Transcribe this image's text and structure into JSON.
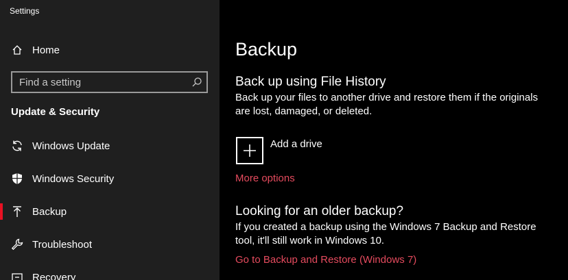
{
  "app": {
    "title": "Settings"
  },
  "colors": {
    "accent": "#e81123",
    "link": "#e54b5e"
  },
  "sidebar": {
    "home_label": "Home",
    "search": {
      "placeholder": "Find a setting",
      "value": ""
    },
    "section_header": "Update & Security",
    "items": [
      {
        "label": "Windows Update",
        "icon": "refresh-icon",
        "selected": false
      },
      {
        "label": "Windows Security",
        "icon": "shield-icon",
        "selected": false
      },
      {
        "label": "Backup",
        "icon": "upload-arrow-icon",
        "selected": true
      },
      {
        "label": "Troubleshoot",
        "icon": "wrench-icon",
        "selected": false
      },
      {
        "label": "Recovery",
        "icon": "recovery-icon",
        "selected": false
      }
    ]
  },
  "main": {
    "title": "Backup",
    "file_history": {
      "heading": "Back up using File History",
      "description_line1": "Back up your files to another drive and restore them if the originals",
      "description_line2": "are lost, damaged, or deleted.",
      "add_drive_label": "Add a drive",
      "more_options": "More options"
    },
    "older_backup": {
      "heading": "Looking for an older backup?",
      "description_line1": "If you created a backup using the Windows 7 Backup and Restore",
      "description_line2": "tool, it'll still work in Windows 10.",
      "link": "Go to Backup and Restore (Windows 7)"
    }
  }
}
